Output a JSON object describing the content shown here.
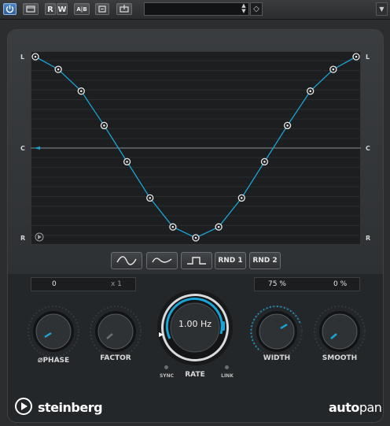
{
  "toolbar": {
    "power_icon": "power-icon",
    "compare_icon": "compare-icon",
    "read_label": "R",
    "write_label": "W",
    "ab_label": "A|B",
    "preset_value": "",
    "more_icon": "chevron-down-icon"
  },
  "graph": {
    "left_label": "L",
    "center_label": "C",
    "right_label": "R",
    "points": [
      0.0,
      0.07,
      0.19,
      0.38,
      0.58,
      0.78,
      0.94,
      1.0,
      0.94,
      0.78,
      0.58,
      0.38,
      0.19,
      0.07,
      0.0
    ],
    "line_color": "#1aa3d6"
  },
  "shapes": {
    "sine_icon": "sine-wave-icon",
    "triangle_icon": "triangle-wave-icon",
    "square_icon": "square-wave-icon",
    "rnd1_label": "RND 1",
    "rnd2_label": "RND 2"
  },
  "fields": {
    "phase_value": "0",
    "factor_value": "x 1",
    "width_value": "75 %",
    "smooth_value": "0 %"
  },
  "knobs": {
    "phase_label": "PHASE",
    "factor_label": "FACTOR",
    "rate_value": "1.00 Hz",
    "rate_label": "RATE",
    "sync_label": "SYNC",
    "link_label": "LINK",
    "width_label": "WIDTH",
    "smooth_label": "SMOOTH"
  },
  "footer": {
    "brand": "steinberg",
    "product_bold": "auto",
    "product_light": "pan"
  },
  "accent_color": "#1aa3d6"
}
